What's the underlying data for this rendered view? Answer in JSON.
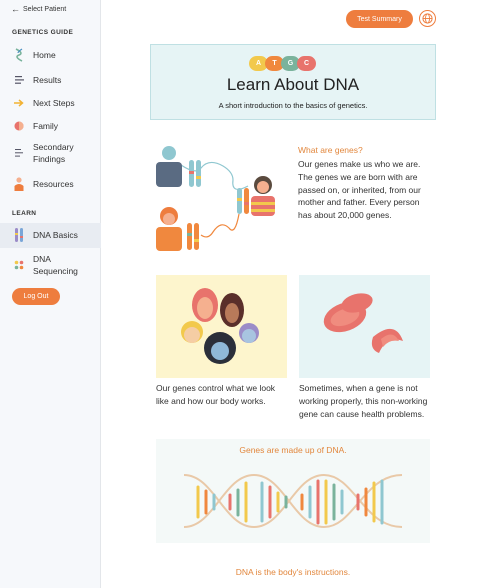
{
  "sidebar": {
    "back_label": "Select Patient",
    "guide_label": "GENETICS GUIDE",
    "guide_items": [
      {
        "label": "Home",
        "icon": "dna-strand-icon"
      },
      {
        "label": "Results",
        "icon": "list-icon"
      },
      {
        "label": "Next Steps",
        "icon": "arrow-right-icon"
      },
      {
        "label": "Family",
        "icon": "family-icon"
      },
      {
        "label": "Secondary Findings",
        "icon": "lines-icon"
      },
      {
        "label": "Resources",
        "icon": "person-icon"
      }
    ],
    "learn_label": "LEARN",
    "learn_items": [
      {
        "label": "DNA Basics",
        "icon": "chromosome-icon"
      },
      {
        "label": "DNA Sequencing",
        "icon": "dots-icon"
      }
    ],
    "logout_label": "Log Out"
  },
  "header": {
    "test_summary_label": "Test Summary",
    "language_icon": "globe-icon"
  },
  "hero": {
    "bases": [
      "A",
      "T",
      "G",
      "C"
    ],
    "title": "Learn About DNA",
    "subtitle": "A short introduction to the basics of genetics."
  },
  "genes": {
    "title": "What are genes?",
    "body": "Our genes make us who we are. The genes we are born with are passed on, or inherited, from our mother and father. Every person has about 20,000 genes."
  },
  "cards": {
    "left_caption": "Our genes control what we look like and how our body works.",
    "right_caption": "Sometimes, when a gene is not working properly, this non-working gene can cause health problems."
  },
  "dna_section": {
    "title": "Genes are made up of DNA."
  },
  "bottom": {
    "title": "DNA is the body's instructions."
  },
  "colors": {
    "accent": "#ee7d3e",
    "heading_orange": "#e2873d",
    "hero_bg": "#e6f4f5",
    "base_A": "#f2c94c",
    "base_T": "#f0883e",
    "base_G": "#7ab39c",
    "base_C": "#e8736c"
  }
}
